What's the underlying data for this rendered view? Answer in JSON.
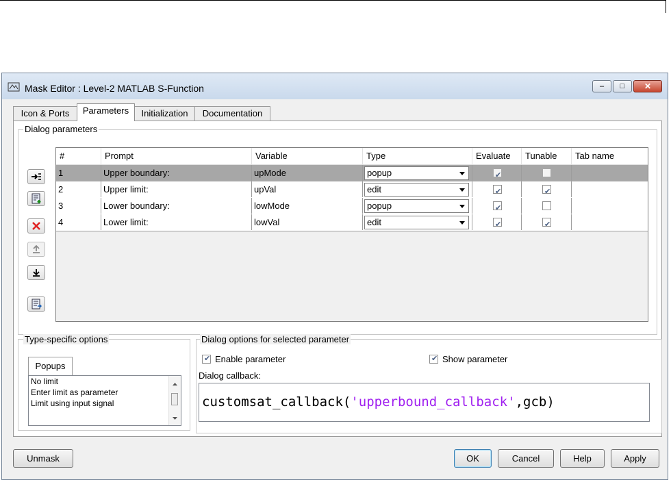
{
  "window": {
    "title": "Mask Editor : Level-2 MATLAB S-Function",
    "minimize_glyph": "–",
    "maximize_glyph": "□",
    "close_glyph": "✕"
  },
  "tabs": [
    {
      "label": "Icon & Ports",
      "active": false
    },
    {
      "label": "Parameters",
      "active": true
    },
    {
      "label": "Initialization",
      "active": false
    },
    {
      "label": "Documentation",
      "active": false
    }
  ],
  "dialog_parameters": {
    "group_label": "Dialog parameters",
    "columns": [
      "#",
      "Prompt",
      "Variable",
      "Type",
      "Evaluate",
      "Tunable",
      "Tab name"
    ],
    "rows": [
      {
        "num": "1",
        "prompt": "Upper boundary:",
        "variable": "upMode",
        "type": "popup",
        "evaluate": true,
        "tunable": false,
        "tab_name": "",
        "selected": true
      },
      {
        "num": "2",
        "prompt": "Upper limit:",
        "variable": "upVal",
        "type": "edit",
        "evaluate": true,
        "tunable": true,
        "tab_name": "",
        "selected": false
      },
      {
        "num": "3",
        "prompt": "Lower boundary:",
        "variable": "lowMode",
        "type": "popup",
        "evaluate": true,
        "tunable": false,
        "tab_name": "",
        "selected": false
      },
      {
        "num": "4",
        "prompt": "Lower limit:",
        "variable": "lowVal",
        "type": "edit",
        "evaluate": true,
        "tunable": true,
        "tab_name": "",
        "selected": false
      }
    ],
    "side_buttons": [
      "insert-parameter-icon",
      "add-parameter-icon",
      "delete-parameter-icon",
      "move-up-icon",
      "move-down-icon",
      "copy-parameters-icon"
    ]
  },
  "type_specific": {
    "group_label": "Type-specific options",
    "tab_label": "Popups",
    "items": [
      "No limit",
      "Enter limit as parameter",
      "Limit using input signal"
    ]
  },
  "dialog_options": {
    "group_label": "Dialog options for selected parameter",
    "enable_label": "Enable parameter",
    "enable_checked": true,
    "show_label": "Show parameter",
    "show_checked": true,
    "callback_label": "Dialog callback:",
    "callback_prefix": "customsat_callback(",
    "callback_string": "'upperbound_callback'",
    "callback_suffix": ",gcb)"
  },
  "buttons": {
    "unmask": "Unmask",
    "ok": "OK",
    "cancel": "Cancel",
    "help": "Help",
    "apply": "Apply"
  },
  "colors": {
    "selected_row": "#a7a7a7",
    "callback_string": "#a020f0",
    "delete_icon": "#e02020"
  }
}
